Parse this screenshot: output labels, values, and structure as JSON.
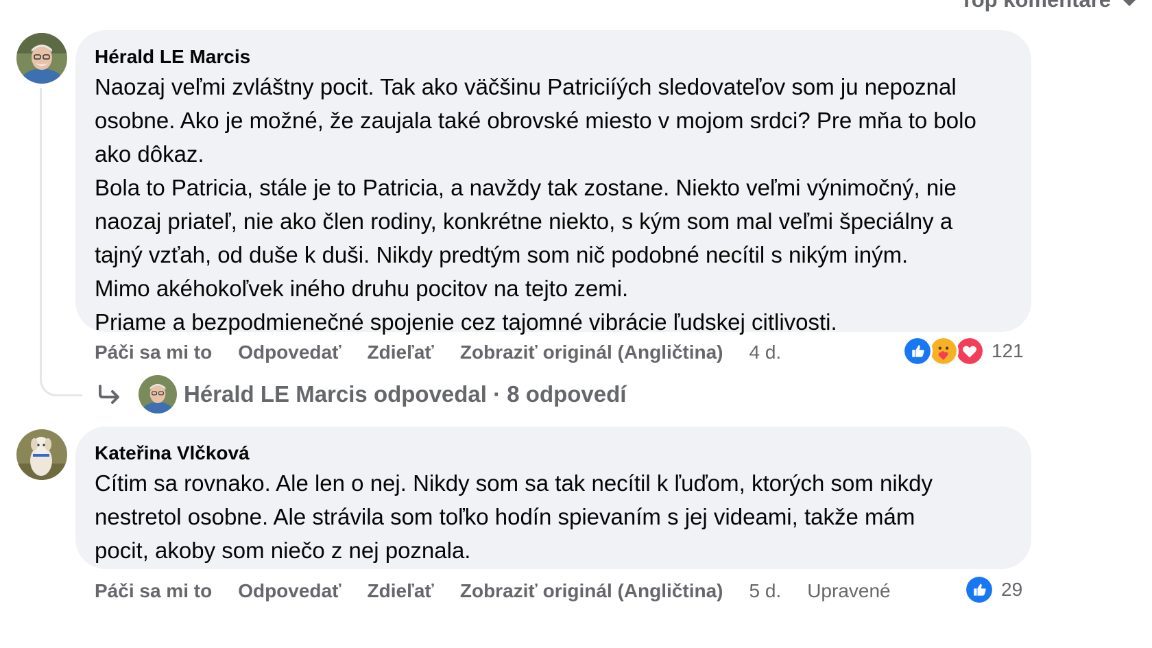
{
  "sort": {
    "label": "Top komentáre",
    "icon": "caret-down-icon"
  },
  "comments": [
    {
      "author": "Hérald LE Marcis",
      "avatar_icon": "man-with-glasses-avatar",
      "lines": [
        "Naozaj veľmi zvláštny pocit. Tak ako väčšinu Patriciíých sledovateľov som ju nepoznal",
        "osobne. Ako je možné, že zaujala také obrovské miesto v mojom srdci? Pre mňa to bolo",
        "ako dôkaz.",
        "Bola to Patricia, stále je to Patricia, a navždy tak zostane. Niekto veľmi výnimočný, nie",
        "naozaj priateľ, nie ako člen rodiny, konkrétne niekto, s kým som mal veľmi špeciálny a",
        "tajný vzťah, od duše k duši. Nikdy predtým som nič podobné necítil s nikým iným.",
        "Mimo akéhokoľvek iného druhu pocitov na tejto zemi.",
        "Priame a bezpodmienečné spojenie cez tajomné vibrácie ľudskej citlivosti."
      ],
      "actions": {
        "like": "Páči sa mi to",
        "reply": "Odpovedať",
        "share": "Zdieľať",
        "translate": "Zobraziť originál (Angličtina)",
        "time": "4 d."
      },
      "reactions": {
        "icons": [
          "like-icon",
          "care-icon",
          "love-icon"
        ],
        "count": "121"
      },
      "replies": {
        "label": "Hérald LE Marcis odpovedal · 8 odpovedí",
        "arrow_icon": "reply-arrow-icon"
      }
    },
    {
      "author": "Kateřina Vlčková",
      "avatar_icon": "dog-avatar",
      "lines": [
        "Cítim sa rovnako. Ale len o nej. Nikdy som sa tak necítil k ľuďom, ktorých som nikdy",
        "nestretol osobne. Ale strávila som toľko hodín spievaním s jej videami, takže mám",
        "pocit, akoby som niečo z nej poznala."
      ],
      "actions": {
        "like": "Páči sa mi to",
        "reply": "Odpovedať",
        "share": "Zdieľať",
        "translate": "Zobraziť originál (Angličtina)",
        "time": "5 d.",
        "edited": "Upravené"
      },
      "reactions": {
        "icons": [
          "like-icon"
        ],
        "count": "29"
      }
    }
  ],
  "colors": {
    "bubble": "#f0f2f5",
    "secondary_text": "#65676b",
    "like_blue": "#1877f2",
    "love_red": "#f33e58",
    "care_yellow": "#f7b125"
  }
}
